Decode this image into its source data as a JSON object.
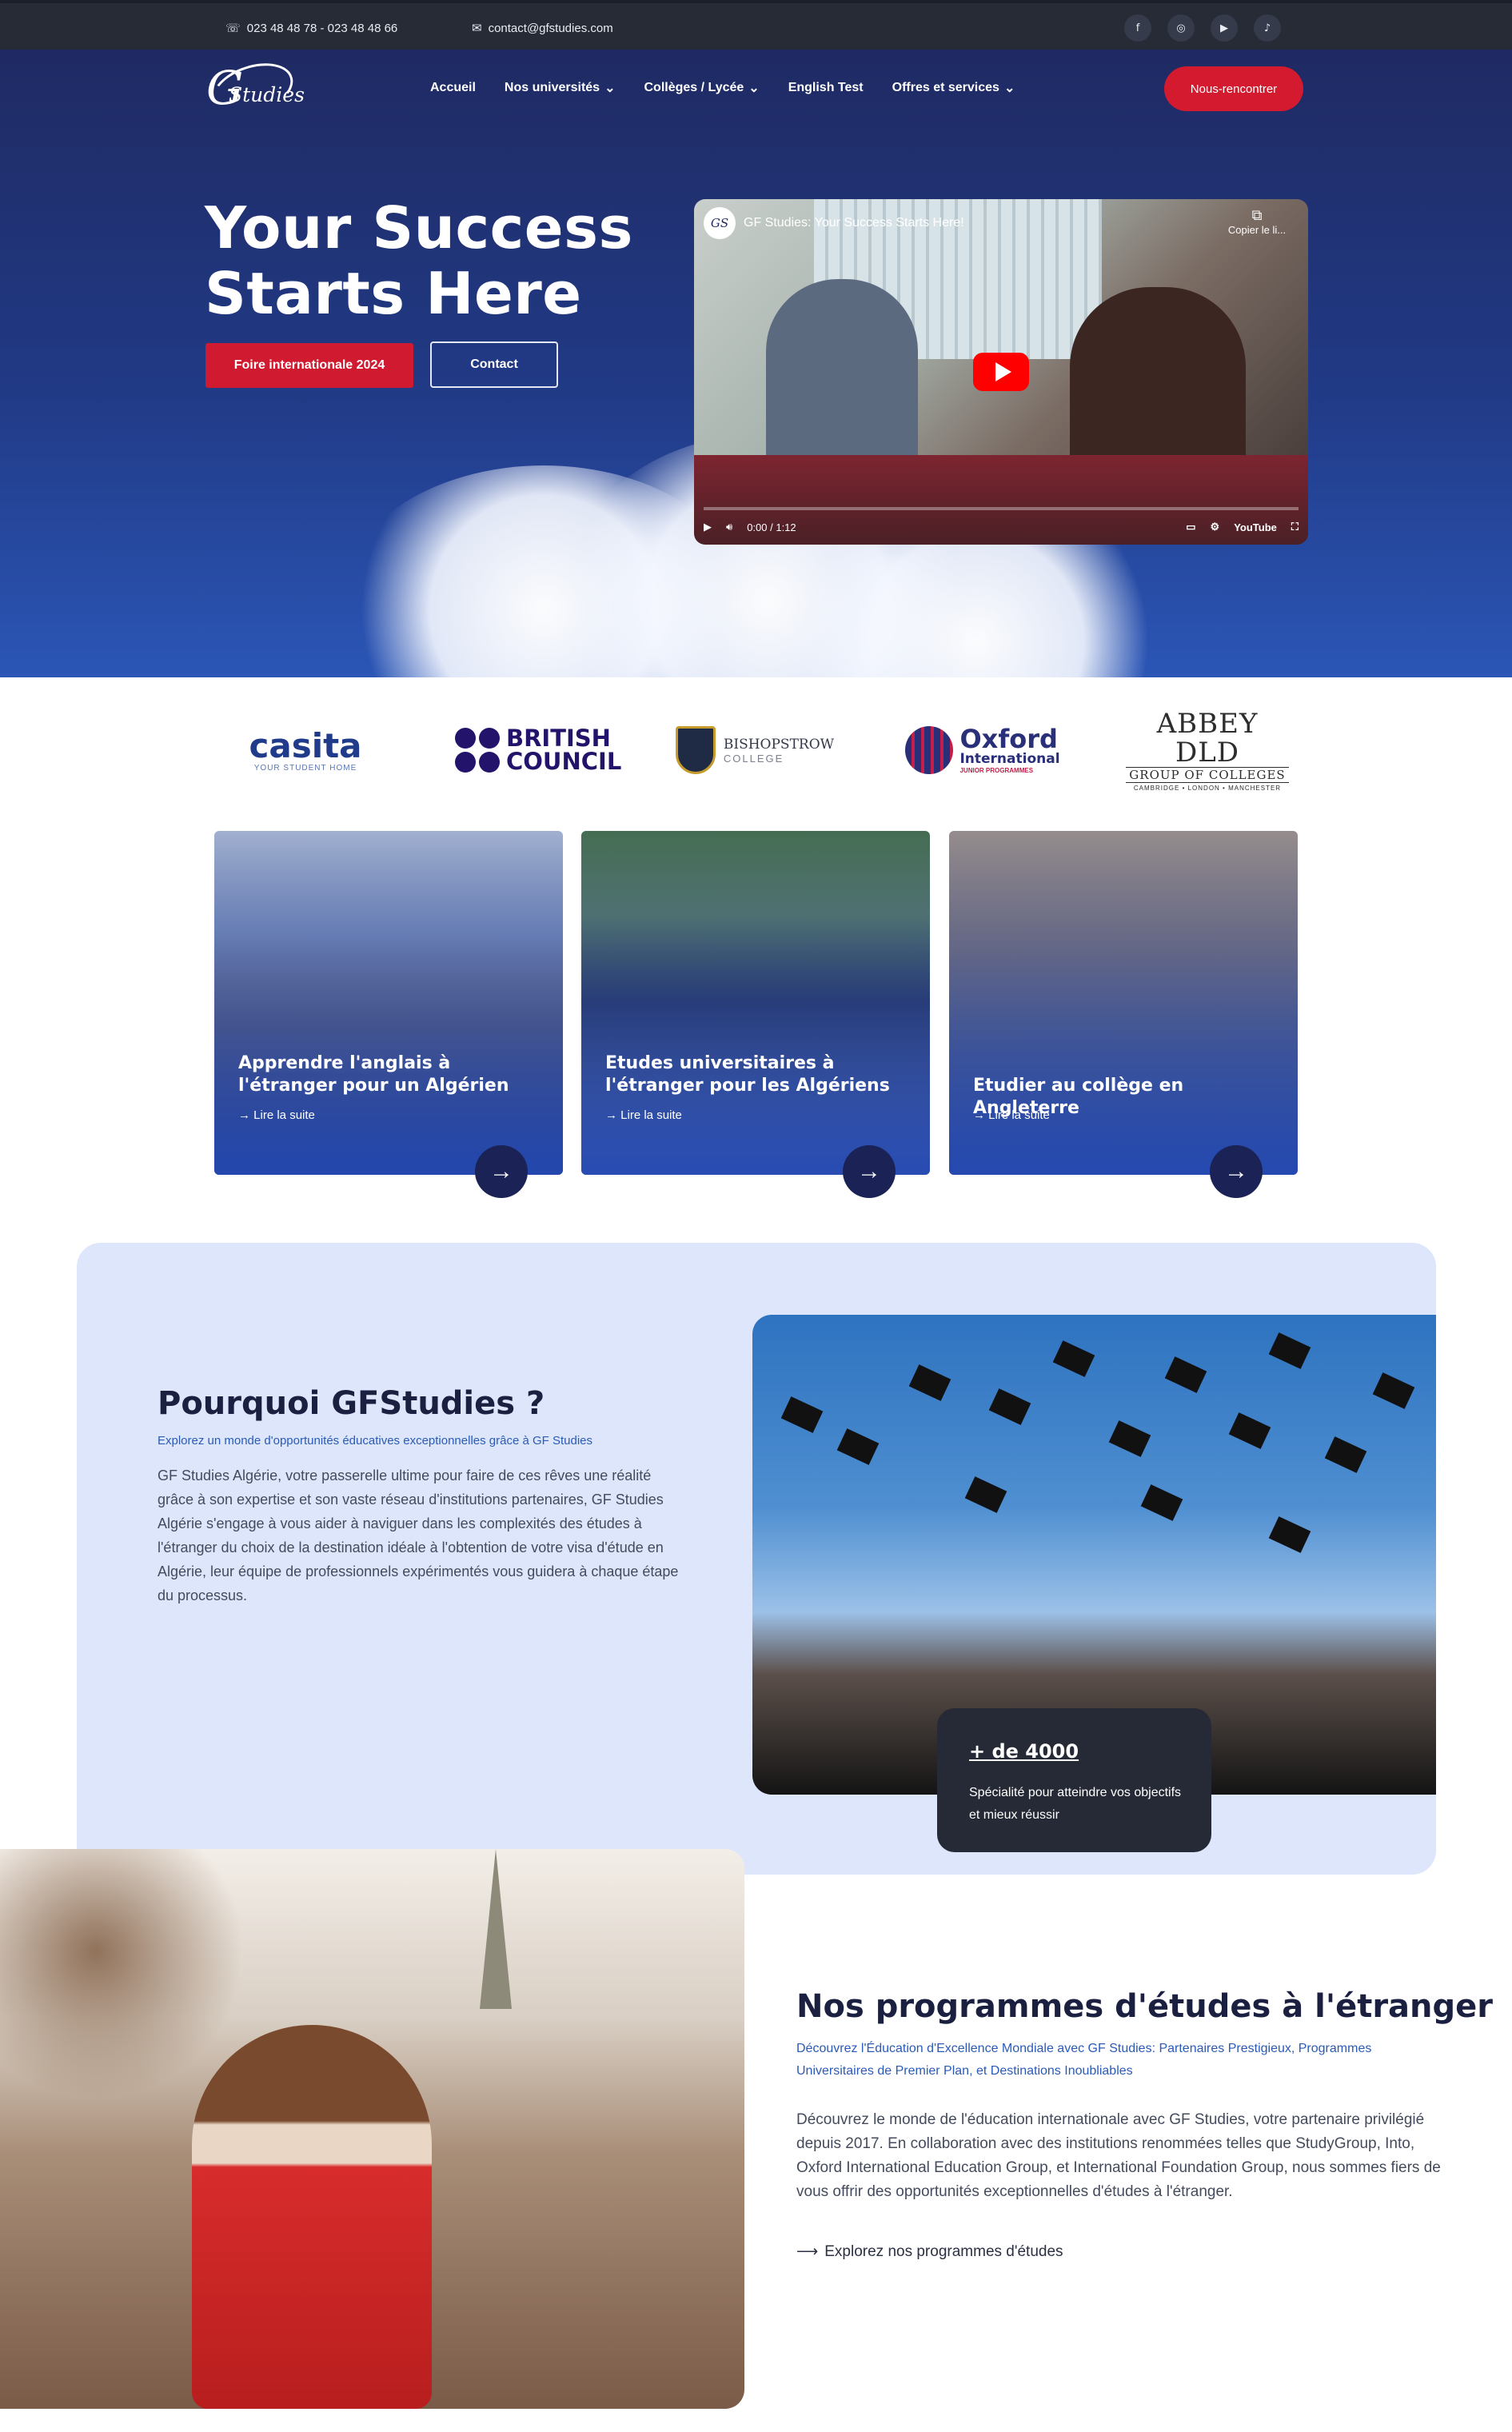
{
  "topbar": {
    "phone": "023 48 48 78 - 023 48 48 66",
    "email": "contact@gfstudies.com",
    "social": [
      "facebook-icon",
      "instagram-icon",
      "youtube-icon",
      "tiktok-icon"
    ]
  },
  "logo": {
    "letter": "G",
    "word": "Studies"
  },
  "nav": {
    "items": [
      {
        "label": "Accueil"
      },
      {
        "label": "Nos universités",
        "dropdown": true
      },
      {
        "label": "Collèges / Lycée",
        "dropdown": true
      },
      {
        "label": "English Test"
      },
      {
        "label": "Offres et services",
        "dropdown": true
      }
    ],
    "cta": "Nous-rencontrer"
  },
  "hero": {
    "title_line1": "Your Success",
    "title_line2": "Starts Here",
    "primary_button": "Foire internationale 2024",
    "secondary_button": "Contact"
  },
  "video": {
    "title": "GF Studies: Your Success Starts Here!",
    "copy_label": "Copier le li...",
    "time": "0:00 / 1:12",
    "brand": "YouTube"
  },
  "partners": [
    {
      "name": "casita",
      "tagline": "YOUR STUDENT HOME"
    },
    {
      "name": "BRITISH COUNCIL"
    },
    {
      "name": "BISHOPSTROW",
      "tagline": "COLLEGE"
    },
    {
      "name": "Oxford",
      "line2": "International",
      "tagline": "JUNIOR PROGRAMMES"
    },
    {
      "name": "ABBEY DLD",
      "line2": "GROUP OF COLLEGES",
      "tagline": "CAMBRIDGE • LONDON • MANCHESTER"
    }
  ],
  "cards": [
    {
      "title": "Apprendre l'anglais à l'étranger pour un Algérien",
      "more": "Lire la suite"
    },
    {
      "title": "Etudes universitaires à l'étranger pour les Algériens",
      "more": "Lire la suite"
    },
    {
      "title": "Etudier au collège en Angleterre",
      "more": "Lire la suite"
    }
  ],
  "why": {
    "title": "Pourquoi GFStudies ?",
    "subtitle": "Explorez un monde d'opportunités éducatives exceptionnelles grâce à GF Studies",
    "text": "GF Studies Algérie, votre passerelle ultime pour faire de ces rêves une réalité grâce à son expertise et son vaste réseau d'institutions partenaires, GF Studies Algérie s'engage à vous aider à naviguer dans les complexités des études à l'étranger du choix de la destination idéale à l'obtention de votre visa d'étude en Algérie, leur équipe de professionnels expérimentés vous guidera à chaque étape du processus.",
    "stat_number": "+ de 4000",
    "stat_text": "Spécialité pour atteindre vos objectifs et mieux réussir"
  },
  "programs": {
    "title": "Nos programmes d'études à l'étranger",
    "subtitle": "Découvrez l'Éducation d'Excellence Mondiale avec GF Studies: Partenaires Prestigieux, Programmes Universitaires de Premier Plan, et Destinations Inoubliables",
    "text": "Découvrez le monde de l'éducation internationale avec GF Studies, votre partenaire privilégié depuis 2017. En collaboration avec des institutions renommées telles que StudyGroup, Into, Oxford International Education Group, et International Foundation Group, nous sommes fiers de vous offrir des opportunités exceptionnelles d'études à l'étranger.",
    "link": "Explorez nos programmes d'études"
  },
  "colors": {
    "accent_red": "#d41a2e",
    "hero_blue": "#213a86",
    "dark": "#262a36",
    "light_panel": "#dde6fb"
  }
}
